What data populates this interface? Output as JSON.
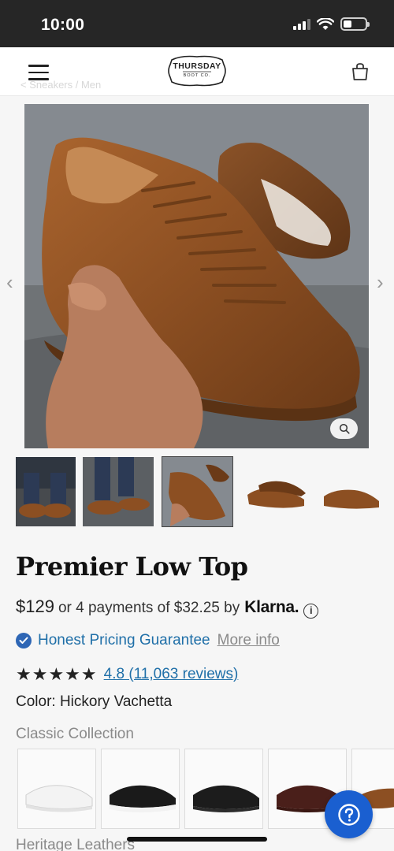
{
  "status_bar": {
    "time": "10:00"
  },
  "header": {
    "logo_text": "THURSDAY",
    "logo_subtext": "BOOT CO.",
    "ghost_breadcrumb": "< Sneakers / Men"
  },
  "product": {
    "title": "Premier Low Top",
    "price": "$129",
    "installment_text": "or 4 payments of $32.25 by",
    "installment_provider": "Klarna.",
    "guarantee_text": "Honest Pricing Guarantee",
    "more_info": "More info",
    "stars": "★★★★★",
    "reviews": "4.8 (11,063 reviews)",
    "color_label": "Color: Hickory Vachetta"
  },
  "collections": {
    "classic": "Classic Collection",
    "heritage": "Heritage Leathers"
  },
  "colors": {
    "accent_blue": "#1f6fa8",
    "help_button": "#1a5fd0",
    "status_bar": "#262626"
  }
}
